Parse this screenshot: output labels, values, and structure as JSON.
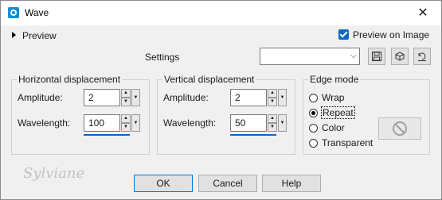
{
  "window": {
    "title": "Wave",
    "close_glyph": "✕"
  },
  "preview": {
    "toggle_label": "Preview",
    "preview_on_image_label": "Preview on Image",
    "preview_on_image_checked": true
  },
  "settings": {
    "label": "Settings",
    "preset_value": ""
  },
  "horizontal": {
    "title": "Horizontal displacement",
    "amplitude_label": "Amplitude:",
    "amplitude_value": "2",
    "wavelength_label": "Wavelength:",
    "wavelength_value": "100"
  },
  "vertical": {
    "title": "Vertical displacement",
    "amplitude_label": "Amplitude:",
    "amplitude_value": "2",
    "wavelength_label": "Wavelength:",
    "wavelength_value": "50"
  },
  "edge_mode": {
    "title": "Edge mode",
    "options": [
      "Wrap",
      "Repeat",
      "Color",
      "Transparent"
    ],
    "selected": "Repeat"
  },
  "buttons": {
    "ok": "OK",
    "cancel": "Cancel",
    "help": "Help"
  },
  "watermark": "Sylviane",
  "colors": {
    "accent": "#0c68c4",
    "window_bg": "#f0f0f0"
  }
}
